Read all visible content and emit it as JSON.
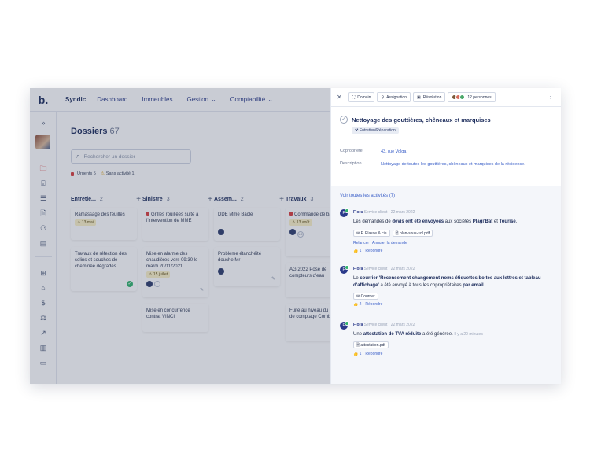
{
  "app": {
    "logo": "b.",
    "name": "Syndic"
  },
  "nav": [
    {
      "label": "Dashboard",
      "caret": ""
    },
    {
      "label": "Immeubles",
      "caret": ""
    },
    {
      "label": "Gestion",
      "caret": "⌄"
    },
    {
      "label": "Comptabilité",
      "caret": "⌄"
    }
  ],
  "rail_icons": [
    "expand-icon",
    "avatar",
    "folder-icon",
    "inbox-icon",
    "list-icon",
    "document-icon",
    "users-icon",
    "archive-icon",
    "table-icon",
    "bank-icon",
    "dollar-icon",
    "scale-icon",
    "chart-icon",
    "ledger-icon",
    "monitor-icon"
  ],
  "main": {
    "title": "Dossiers",
    "count": "67",
    "search_placeholder": "Rechercher un dossier",
    "chips": [
      {
        "icon": "🟥",
        "label": "Urgents 5"
      },
      {
        "icon": "⚠️",
        "label": "Sans activité 1"
      }
    ]
  },
  "columns": [
    {
      "title": "Entretie...",
      "count": "2",
      "plus": "+"
    },
    {
      "title": "Sinistre",
      "count": "3",
      "plus": "+"
    },
    {
      "title": "Assem...",
      "count": "2",
      "plus": "+"
    },
    {
      "title": "Travaux",
      "count": "3",
      "plus": ""
    }
  ],
  "cards": {
    "c1a": {
      "text": "Ramassage des feuilles",
      "tag": "⚠ 13 mai"
    },
    "c1b": {
      "text": "Travaux de réfection des solins et souches de cheminée dégradés"
    },
    "c2a": {
      "text": "Grilles rouillées suite à l'intervention de MME"
    },
    "c2b": {
      "text": "Mise en alarme des chaudières vers 09:30 le mardi 20/11/2021",
      "tag": "⚠ 15 juillet"
    },
    "c2c": {
      "text": "Mise en concurrence contrat VINCI"
    },
    "c3a": {
      "text": "DDE Mme Bacle"
    },
    "c3b": {
      "text": "Problème étanchéité douche Mr"
    },
    "c4a": {
      "text": "Commande de badges",
      "tag": "⚠ 13 août"
    },
    "c4b": {
      "text": "AG 2022 Pose de compteurs d'eau"
    },
    "c4c": {
      "text": "Fuite au niveau du système de comptage Combe"
    },
    "initials": "LD"
  },
  "panel": {
    "toolbar": {
      "close": "✕",
      "domain": "Domain",
      "assignation": "Assignation",
      "resolution": "Résolution",
      "people": "12 personnes",
      "menu": "⋮"
    },
    "title": "Nettoyage des gouttières, chêneaux et marquises",
    "category": "⚒ Entretien/Réparation",
    "copro_label": "Copropriété",
    "copro_value": "43, rue Volga",
    "desc_label": "Description",
    "desc_value": "Nettoyage de toutes les gouttières, chêneaux et marquises de la résidence.",
    "all_link": "Voir toutes les activités (7)",
    "activities": [
      {
        "who": "Flora",
        "meta": "Service client · 22 mars 2022",
        "text_pre": "Les demandes de ",
        "text_b1": "devis ont été envoyées",
        "text_mid": " aux sociétés ",
        "text_b2": "Plagi'Bat",
        "text_and": " et ",
        "text_b3": "Tourise",
        "text_end": ".",
        "attachments": [
          "✉ P. Plasse & cie",
          "🗎 plan-sous-sol.pdf"
        ],
        "link1": "Relancer",
        "link2": "Annuler la demande",
        "likes": "👍 1",
        "reply": "Répondre"
      },
      {
        "who": "Flora",
        "meta": "Service client · 22 mars 2022",
        "text_pre": "Le ",
        "text_b1": "courrier 'Recensement changement noms étiquettes boites aux lettres et tableau d'affichage'",
        "text_mid": " a été envoyé à tous les copropriétaires ",
        "text_b2": "par email",
        "text_end": ".",
        "attachments": [
          "✉ Courrier"
        ],
        "likes": "👍 2",
        "reply": "Répondre"
      },
      {
        "who": "Flora",
        "meta": "Service client · 22 mars 2022",
        "text_pre": "Une ",
        "text_b1": "attestation de TVA réduite",
        "text_mid": " a été générée.",
        "text_time": "Il y a 20 minutes",
        "attachments": [
          "🗎 attestation.pdf"
        ],
        "likes": "👍 1",
        "reply": "Répondre"
      }
    ]
  },
  "colors": {
    "accent": "#3a5fc8",
    "navy": "#1a2a5a",
    "success": "#2fb36b",
    "overlay": "rgba(60,72,100,0.28)"
  }
}
